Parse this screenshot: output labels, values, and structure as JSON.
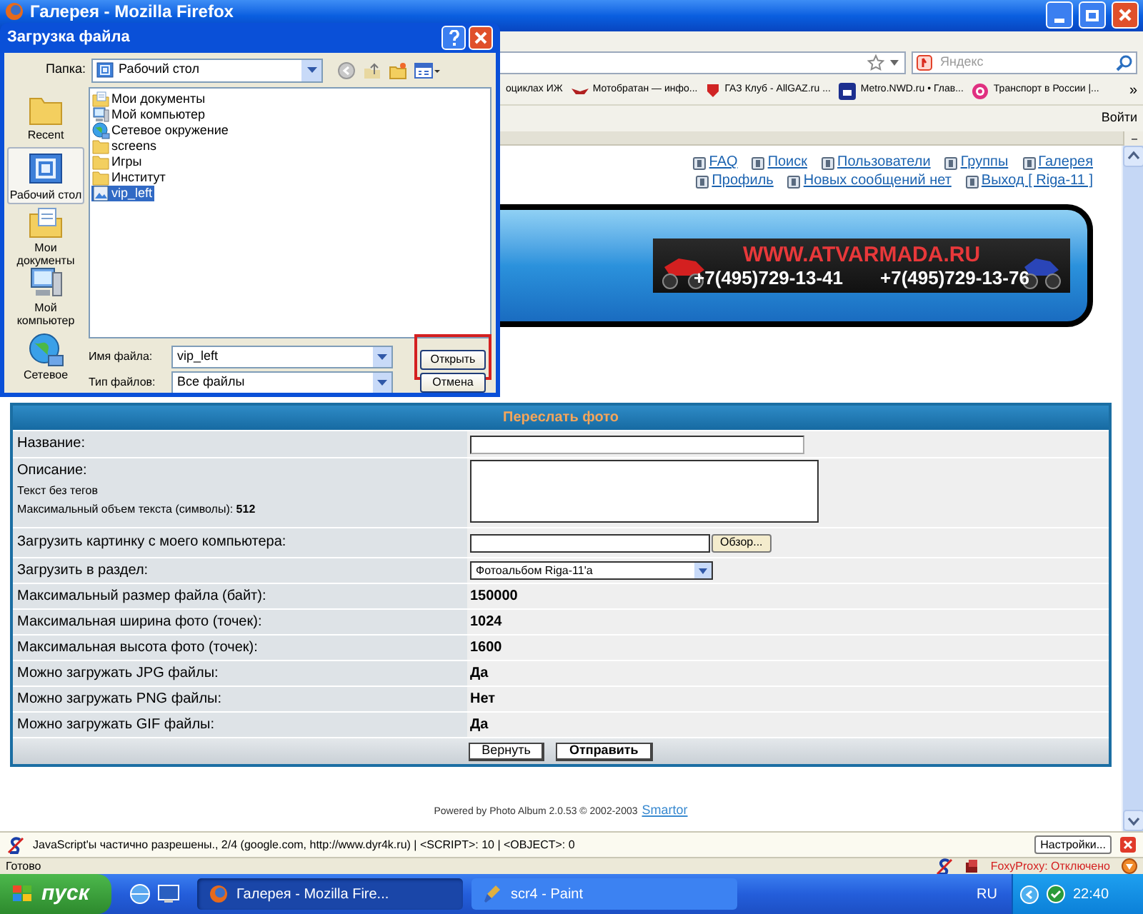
{
  "browser": {
    "title": "Галерея - Mozilla Firefox",
    "search_placeholder": "Яндекс",
    "bookmarks": [
      {
        "label": "оциклах ИЖ",
        "kind": "none"
      },
      {
        "label": "Мотобратан — инфо...",
        "kind": "wings"
      },
      {
        "label": "ГАЗ Клуб - AllGAZ.ru ...",
        "kind": "shield"
      },
      {
        "label": "Metro.NWD.ru • Глав...",
        "kind": "metro"
      },
      {
        "label": "Транспорт в России |...",
        "kind": "target"
      }
    ],
    "more": "»",
    "login": "Войти"
  },
  "page": {
    "nav_rows": [
      [
        {
          "label": "FAQ"
        },
        {
          "label": "Поиск"
        },
        {
          "label": "Пользователи"
        },
        {
          "label": "Группы"
        },
        {
          "label": "Галерея"
        }
      ],
      [
        {
          "label": "Профиль"
        },
        {
          "label": "Новых сообщений нет"
        },
        {
          "label": "Выход [ Riga-11 ]"
        }
      ]
    ],
    "banner": {
      "site": "WWW.ATVARMADA.RU",
      "phones": [
        "+7(495)729-13-41",
        "+7(495)729-13-76"
      ]
    },
    "form": {
      "title": "Переслать фото",
      "rows": [
        {
          "kind": "text_input",
          "label": "Название:"
        },
        {
          "kind": "textarea",
          "label": "Описание:",
          "notes": [
            "Текст без тегов",
            "Максимальный объем текста (символы): **512**"
          ]
        },
        {
          "kind": "file_input",
          "label": "Загрузить картинку с моего компьютера:",
          "button": "Обзор..."
        },
        {
          "kind": "select",
          "label": "Загрузить в раздел:",
          "value": "Фотоальбом Riga-11'a"
        },
        {
          "kind": "value",
          "label": "Максимальный размер файла (байт):",
          "value": "150000"
        },
        {
          "kind": "value",
          "label": "Максимальная ширина фото (точек):",
          "value": "1024"
        },
        {
          "kind": "value",
          "label": "Максимальная высота фото (точек):",
          "value": "1600"
        },
        {
          "kind": "value",
          "label": "Можно загружать JPG файлы:",
          "value": "Да"
        },
        {
          "kind": "value",
          "label": "Можно загружать PNG файлы:",
          "value": "Нет"
        },
        {
          "kind": "value",
          "label": "Можно загружать GIF файлы:",
          "value": "Да"
        }
      ],
      "buttons": [
        {
          "label": "Вернуть",
          "primary": false
        },
        {
          "label": "Отправить",
          "primary": true
        }
      ]
    },
    "footer": {
      "text": "Powered by Photo Album 2.0.53 © 2002-2003",
      "link": "Smartor"
    }
  },
  "noscript_bar": {
    "text": "JavaScript'ы частично разрешены., 2/4 (google.com, http://www.dyr4k.ru) | <SCRIPT>: 10 | <OBJECT>: 0",
    "button": "Настройки..."
  },
  "status_bar": {
    "text": "Готово",
    "proxy": "FoxyProxy: Отключено"
  },
  "taskbar": {
    "start": "пуск",
    "tasks": [
      {
        "label": "Галерея - Mozilla Fire...",
        "kind": "firefox",
        "selected": true
      },
      {
        "label": "scr4 - Paint",
        "kind": "paint",
        "selected": false
      }
    ],
    "language": "RU",
    "clock": "22:40"
  },
  "dialog": {
    "title": "Загрузка файла",
    "folder_label": "Папка:",
    "folder": "Рабочий стол",
    "places": [
      {
        "label": "Recent",
        "kind": "recent",
        "selected": false
      },
      {
        "label": "Рабочий стол",
        "kind": "desktop",
        "selected": true
      },
      {
        "label": "Мои документы",
        "kind": "documents",
        "selected": false
      },
      {
        "label": "Мой компьютер",
        "kind": "computer",
        "selected": false
      },
      {
        "label": "Сетевое",
        "kind": "network",
        "selected": false
      }
    ],
    "files": [
      {
        "name": "Мои документы",
        "kind": "documents",
        "selected": false
      },
      {
        "name": "Мой компьютер",
        "kind": "computer",
        "selected": false
      },
      {
        "name": "Сетевое окружение",
        "kind": "network",
        "selected": false
      },
      {
        "name": "screens",
        "kind": "folder",
        "selected": false
      },
      {
        "name": "Игры",
        "kind": "folder",
        "selected": false
      },
      {
        "name": "Институт",
        "kind": "folder",
        "selected": false
      },
      {
        "name": "vip_left",
        "kind": "image",
        "selected": true
      }
    ],
    "filename_label": "Имя файла:",
    "filename": "vip_left",
    "type_label": "Тип файлов:",
    "type": "Все файлы",
    "open_button": {
      "label": "Открыть",
      "highlighted": true
    },
    "cancel_button": "Отмена"
  }
}
